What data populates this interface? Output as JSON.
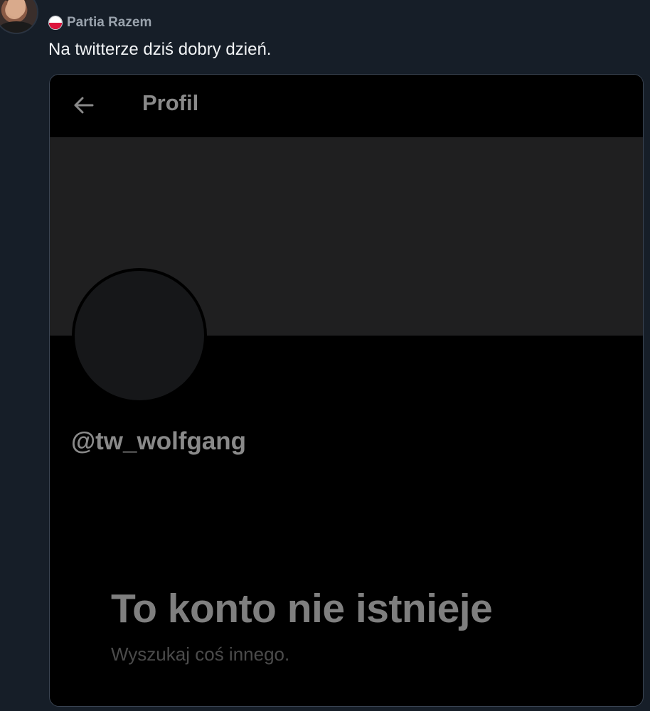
{
  "post": {
    "affiliation": "Partia Razem",
    "text": "Na twitterze dziś dobry dzień.",
    "flag_colors": {
      "top": "#ffffff",
      "bottom": "#dc143c"
    }
  },
  "embedded_screenshot": {
    "header_title": "Profil",
    "back_icon": "arrow-left-icon",
    "handle": "@tw_wolfgang",
    "empty_state_title": "To konto nie istnieje",
    "empty_state_subtitle": "Wyszukaj coś innego.",
    "colors": {
      "background": "#000000",
      "banner": "#1f1f20",
      "text_muted": "#8a8a8a"
    }
  },
  "theme": {
    "page_background": "#161e28",
    "text_primary": "#f2f4f6"
  }
}
